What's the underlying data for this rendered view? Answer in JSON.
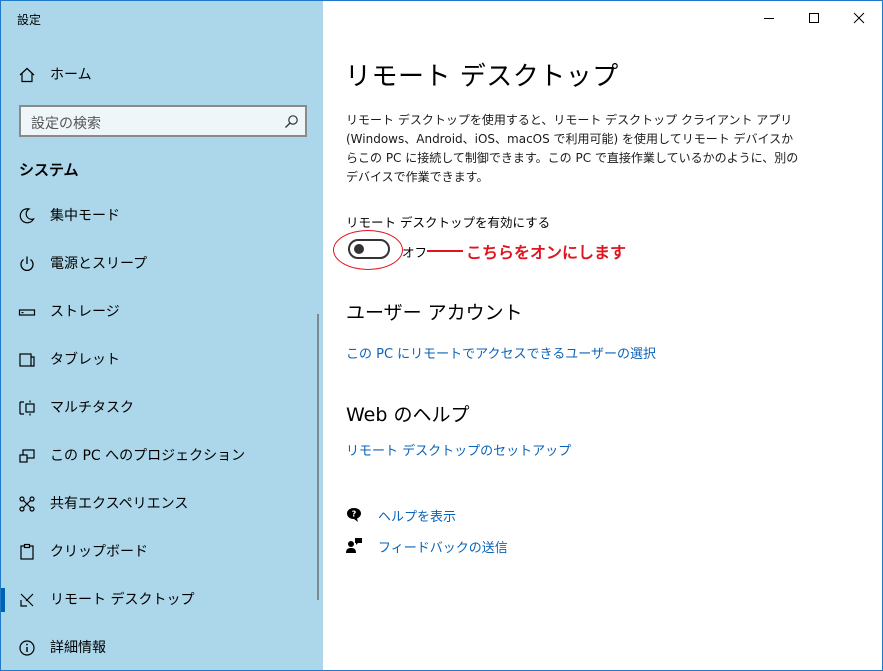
{
  "window": {
    "app_title": "設定"
  },
  "sidebar": {
    "home_label": "ホーム",
    "search_placeholder": "設定の検索",
    "section_title": "システム",
    "items": [
      {
        "label": "集中モード",
        "icon": "moon-icon"
      },
      {
        "label": "電源とスリープ",
        "icon": "power-icon"
      },
      {
        "label": "ストレージ",
        "icon": "storage-icon"
      },
      {
        "label": "タブレット",
        "icon": "tablet-icon"
      },
      {
        "label": "マルチタスク",
        "icon": "multitask-icon"
      },
      {
        "label": "この PC へのプロジェクション",
        "icon": "projection-icon"
      },
      {
        "label": "共有エクスペリエンス",
        "icon": "share-icon"
      },
      {
        "label": "クリップボード",
        "icon": "clipboard-icon"
      },
      {
        "label": "リモート デスクトップ",
        "icon": "remote-desktop-icon",
        "selected": true
      },
      {
        "label": "詳細情報",
        "icon": "info-icon"
      }
    ]
  },
  "main": {
    "title": "リモート デスクトップ",
    "description_lines": [
      "リモート デスクトップを使用すると、リモート デスクトップ クライアント アプリ",
      "(Windows、Android、iOS、macOS で利用可能) を使用してリモート デバイスか",
      "らこの PC に接続して制御できます。この PC で直接作業しているかのように、別の",
      "デバイスで作業できます。"
    ],
    "toggle": {
      "label": "リモート デスクトップを有効にする",
      "state_text": "オフ",
      "on": false
    },
    "annotation": {
      "text": "こちらをオンにします",
      "color": "#e0141e"
    },
    "user_accounts": {
      "heading": "ユーザー アカウント",
      "link": "この PC にリモートでアクセスできるユーザーの選択"
    },
    "web_help": {
      "heading": "Web のヘルプ",
      "link": "リモート デスクトップのセットアップ"
    },
    "footer": {
      "help_label": "ヘルプを表示",
      "feedback_label": "フィードバックの送信"
    }
  },
  "colors": {
    "sidebar_bg": "#acd7ea",
    "accent": "#0063b1",
    "link": "#0b63b8",
    "annotation": "#e0141e"
  }
}
